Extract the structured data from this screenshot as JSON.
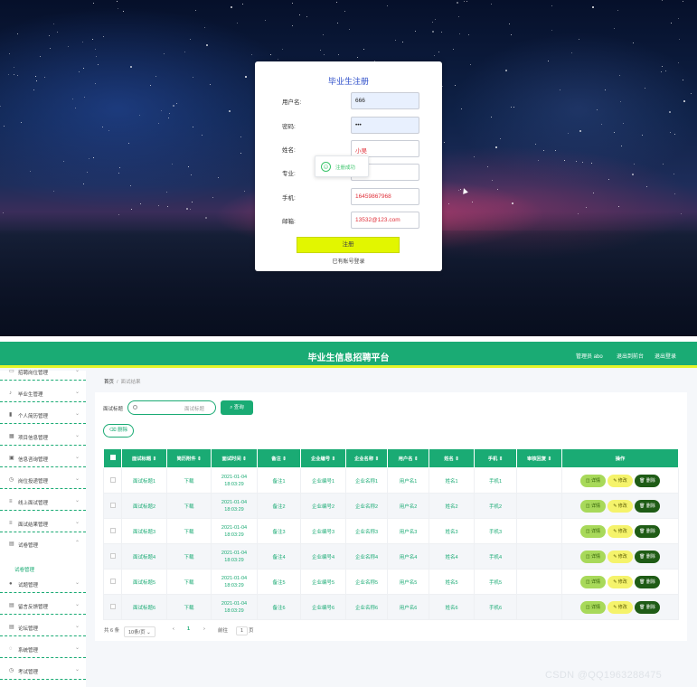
{
  "register": {
    "title": "毕业生注册",
    "fields": [
      {
        "label": "用户名:",
        "value": "666",
        "filled": true
      },
      {
        "label": "密码:",
        "value": "•••",
        "filled": true
      },
      {
        "label": "姓名:",
        "value": "小吴",
        "filled": false
      },
      {
        "label": "专业:",
        "value": "",
        "filled": false
      },
      {
        "label": "手机:",
        "value": "16459867968",
        "filled": false
      },
      {
        "label": "邮箱:",
        "value": "13532@123.com",
        "filled": false
      }
    ],
    "toast": {
      "icon": "success-icon",
      "text": "注册成功"
    },
    "submit_label": "注册",
    "login_link": "已有账号登录"
  },
  "admin": {
    "header": {
      "title": "毕业生信息招聘平台",
      "user": "管理员 abo",
      "back": "退出到前台",
      "logout": "退出登录"
    },
    "sidebar": [
      {
        "icon": "folder-icon",
        "label": "招聘岗位管理"
      },
      {
        "icon": "mic-icon",
        "label": "毕业生管理"
      },
      {
        "icon": "chart-icon",
        "label": "个人简历管理"
      },
      {
        "icon": "grid-icon",
        "label": "项目信息管理"
      },
      {
        "icon": "building-icon",
        "label": "信息咨询管理"
      },
      {
        "icon": "clock-icon",
        "label": "岗位投递管理"
      },
      {
        "icon": "list-icon",
        "label": "线上面试管理"
      },
      {
        "icon": "list-icon",
        "label": "面试结果管理"
      },
      {
        "icon": "doc-icon",
        "label": "试卷管理"
      },
      {
        "icon": "user-icon",
        "label": "试题管理"
      },
      {
        "icon": "doc-icon",
        "label": "留言反馈管理"
      },
      {
        "icon": "doc-icon",
        "label": "论坛管理"
      },
      {
        "icon": "chat-icon",
        "label": "系统管理"
      },
      {
        "icon": "clock-icon",
        "label": "考试管理"
      }
    ],
    "submenu_item": "试卷管理",
    "breadcrumb": {
      "home": "首页",
      "sep": "/",
      "current": "面试结果"
    },
    "search": {
      "label": "面试标题",
      "placeholder": "面试标题",
      "button": "查询"
    },
    "delete_button": "删除",
    "table": {
      "columns": [
        "面试标题 ⇕",
        "简历附件 ⇕",
        "面试时间 ⇕",
        "备注 ⇕",
        "企业编号 ⇕",
        "企业名称 ⇕",
        "用户名 ⇕",
        "姓名 ⇕",
        "手机 ⇕",
        "审核回复 ⇕",
        "操作"
      ],
      "rows": [
        [
          "面试标题1",
          "下载",
          "2021-01-04 18:03:29",
          "备注1",
          "企业编号1",
          "企业名称1",
          "用户名1",
          "姓名1",
          "手机1",
          ""
        ],
        [
          "面试标题2",
          "下载",
          "2021-01-04 18:03:29",
          "备注2",
          "企业编号2",
          "企业名称2",
          "用户名2",
          "姓名2",
          "手机2",
          ""
        ],
        [
          "面试标题3",
          "下载",
          "2021-01-04 18:03:29",
          "备注3",
          "企业编号3",
          "企业名称3",
          "用户名3",
          "姓名3",
          "手机3",
          ""
        ],
        [
          "面试标题4",
          "下载",
          "2021-01-04 18:03:29",
          "备注4",
          "企业编号4",
          "企业名称4",
          "用户名4",
          "姓名4",
          "手机4",
          ""
        ],
        [
          "面试标题5",
          "下载",
          "2021-01-04 18:03:29",
          "备注5",
          "企业编号5",
          "企业名称5",
          "用户名5",
          "姓名5",
          "手机5",
          ""
        ],
        [
          "面试标题6",
          "下载",
          "2021-01-04 18:03:29",
          "备注6",
          "企业编号6",
          "企业名称6",
          "用户名6",
          "姓名6",
          "手机6",
          ""
        ]
      ],
      "actions": [
        "详情",
        "修改",
        "删除"
      ]
    },
    "pager": {
      "total": "共 6 条",
      "size": "10条/页",
      "prev": "‹",
      "page": "1",
      "next": "›",
      "goto": "前往",
      "goto_value": "1",
      "unit": "页"
    },
    "colors": {
      "primary": "#1aab74",
      "accent_bar": "#e3f528"
    }
  },
  "watermark": "CSDN @QQ1963288475"
}
